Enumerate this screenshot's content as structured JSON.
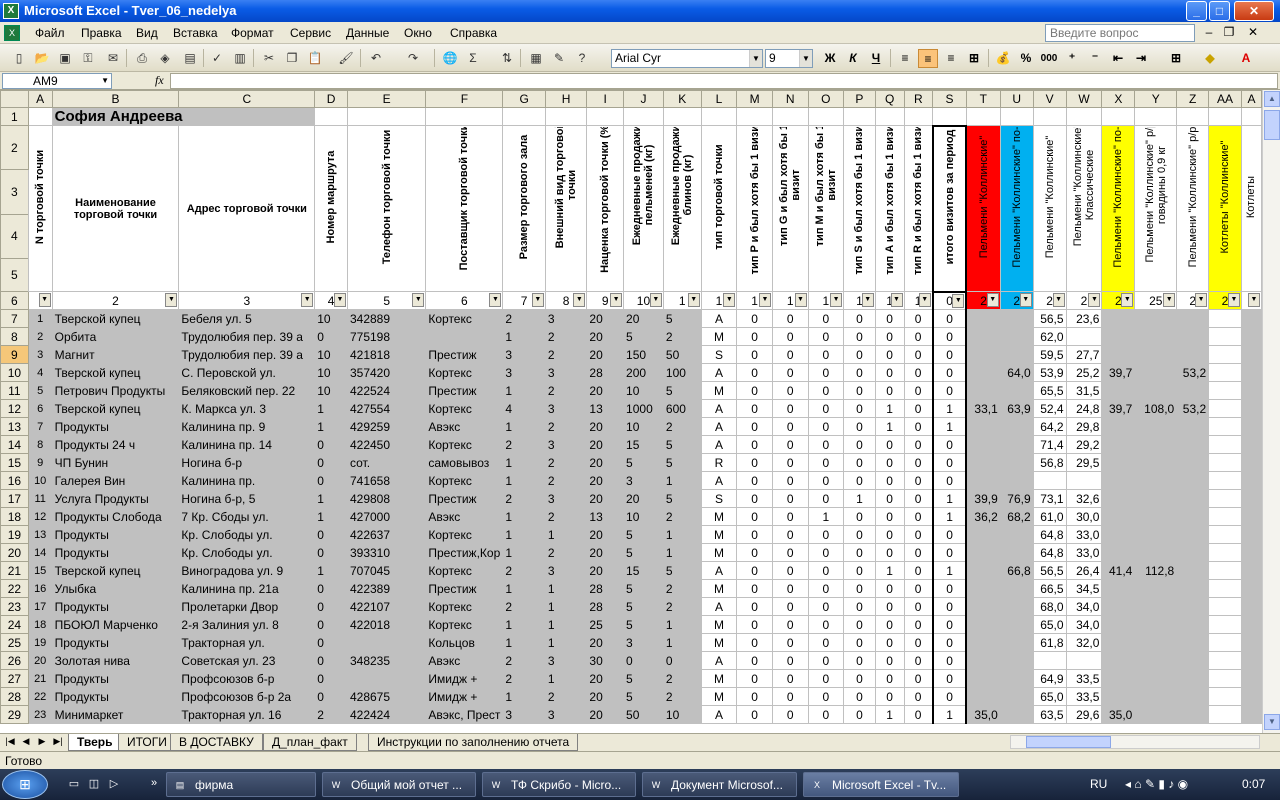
{
  "window": {
    "title": "Microsoft Excel - Tver_06_nedelya",
    "min": "_",
    "max": "□",
    "close": "✕"
  },
  "menu": [
    "Файл",
    "Правка",
    "Вид",
    "Вставка",
    "Формат",
    "Сервис",
    "Данные",
    "Окно",
    "Справка"
  ],
  "ask_placeholder": "Введите вопрос",
  "toolbar": {
    "font": "Arial Cyr",
    "size": "9",
    "sigma": "Σ",
    "percent": "%",
    "thousands": "000",
    "bold": "Ж",
    "italic": "К",
    "underline": "Ч"
  },
  "namebox": "AM9",
  "fx": "fx",
  "columns": [
    "A",
    "B",
    "C",
    "D",
    "E",
    "F",
    "G",
    "H",
    "I",
    "J",
    "K",
    "L",
    "M",
    "N",
    "O",
    "P",
    "Q",
    "R",
    "S",
    "T",
    "U",
    "V",
    "W",
    "X",
    "Y",
    "Z",
    "AA",
    "A"
  ],
  "row1": {
    "num": "1",
    "name": "София Андреева"
  },
  "header_rows": [
    "2",
    "3",
    "4",
    "5"
  ],
  "headers": [
    "N торговой точки",
    "Наименование торговой точки",
    "Адрес торговой точки",
    "Номер маршрута",
    "Телефон торговой точки",
    "Поставщик торговой точки",
    "Размер торгового зала",
    "Внешний вид торговой точки",
    "Наценка торговой точки (%)",
    "Ежедневные продажи пельменей (кг)",
    "Ежедневные продажи блинов (кг)",
    "тип торговой точки",
    "тип P и был хотя бы 1 визит",
    "тип G и был хотя бы 1 визит",
    "тип M и был хотя бы 1 визит",
    "тип S и был хотя бы 1 визит",
    "тип A и был хотя бы 1 визит",
    "тип R и был хотя бы 1 визит",
    "итого визитов за период",
    "Пельмени \"Коллинские\"",
    "Пельмени \"Коллинские\" по-",
    "Пельмени \"Коллинские\"",
    "Пельмени \"Коллинские\" Классические",
    "Пельмени \"Коллинские\" по-",
    "Пельмени \"Коллинские\" р/р из говядины 0,9 кг",
    "Пельмени \"Коллинские\" р/р",
    "Котлеты \"Коллинские\"",
    "Котлеты"
  ],
  "filter_row": {
    "num": "6",
    "labels": [
      "",
      "2",
      "3",
      "4",
      "5",
      "6",
      "7",
      "8",
      "9",
      "10",
      "1",
      "1",
      "1",
      "1",
      "1",
      "1",
      "1",
      "1",
      "0",
      "2",
      "2",
      "2",
      "2",
      "2",
      "25",
      "2",
      "2",
      "2"
    ]
  },
  "rows": [
    {
      "n": "7",
      "c": [
        "1",
        "Тверской купец",
        "Бебеля ул. 5",
        "10",
        "342889",
        "Кортекс",
        "2",
        "3",
        "20",
        "20",
        "5",
        "A",
        "0",
        "0",
        "0",
        "0",
        "0",
        "0",
        "0",
        "",
        "",
        "56,5",
        "23,6",
        "",
        "",
        "",
        "",
        ""
      ]
    },
    {
      "n": "8",
      "c": [
        "2",
        "Орбита",
        "Трудолюбия пер. 39 а",
        "0",
        "775198",
        "",
        "1",
        "2",
        "20",
        "5",
        "2",
        "M",
        "0",
        "0",
        "0",
        "0",
        "0",
        "0",
        "0",
        "",
        "",
        "62,0",
        "",
        "",
        "",
        "",
        "",
        ""
      ]
    },
    {
      "n": "9",
      "c": [
        "3",
        "Магнит",
        "Трудолюбия пер. 39 а",
        "10",
        "421818",
        "Престиж",
        "3",
        "2",
        "20",
        "150",
        "50",
        "S",
        "0",
        "0",
        "0",
        "0",
        "0",
        "0",
        "0",
        "",
        "",
        "59,5",
        "27,7",
        "",
        "",
        "",
        "",
        ""
      ]
    },
    {
      "n": "10",
      "c": [
        "4",
        "Тверской купец",
        "С. Перовской ул.",
        "10",
        "357420",
        "Кортекс",
        "3",
        "3",
        "28",
        "200",
        "100",
        "A",
        "0",
        "0",
        "0",
        "0",
        "0",
        "0",
        "0",
        "",
        "64,0",
        "53,9",
        "25,2",
        "39,7",
        "",
        "53,2",
        "",
        ""
      ]
    },
    {
      "n": "11",
      "c": [
        "5",
        "Петрович Продукты",
        "Беляковский пер. 22",
        "10",
        "422524",
        "Престиж",
        "1",
        "2",
        "20",
        "10",
        "5",
        "M",
        "0",
        "0",
        "0",
        "0",
        "0",
        "0",
        "0",
        "",
        "",
        "65,5",
        "31,5",
        "",
        "",
        "",
        "",
        ""
      ]
    },
    {
      "n": "12",
      "c": [
        "6",
        "Тверской купец",
        "К. Маркса ул. 3",
        "1",
        "427554",
        "Кортекс",
        "4",
        "3",
        "13",
        "1000",
        "600",
        "A",
        "0",
        "0",
        "0",
        "0",
        "1",
        "0",
        "1",
        "33,1",
        "63,9",
        "52,4",
        "24,8",
        "39,7",
        "108,0",
        "53,2",
        "",
        ""
      ]
    },
    {
      "n": "13",
      "c": [
        "7",
        "Продукты",
        "Калинина пр. 9",
        "1",
        "429259",
        "Авэкс",
        "1",
        "2",
        "20",
        "10",
        "2",
        "A",
        "0",
        "0",
        "0",
        "0",
        "1",
        "0",
        "1",
        "",
        "",
        "64,2",
        "29,8",
        "",
        "",
        "",
        "",
        ""
      ]
    },
    {
      "n": "14",
      "c": [
        "8",
        "Продукты 24 ч",
        "Калинина пр. 14",
        "0",
        "422450",
        "Кортекс",
        "2",
        "3",
        "20",
        "15",
        "5",
        "A",
        "0",
        "0",
        "0",
        "0",
        "0",
        "0",
        "0",
        "",
        "",
        "71,4",
        "29,2",
        "",
        "",
        "",
        "",
        ""
      ]
    },
    {
      "n": "15",
      "c": [
        "9",
        "ЧП Бунин",
        "Ногина б-р",
        "0",
        "сот.",
        "самовывоз",
        "1",
        "2",
        "20",
        "5",
        "5",
        "R",
        "0",
        "0",
        "0",
        "0",
        "0",
        "0",
        "0",
        "",
        "",
        "56,8",
        "29,5",
        "",
        "",
        "",
        "",
        ""
      ]
    },
    {
      "n": "16",
      "c": [
        "10",
        "Галерея Вин",
        "Калинина пр.",
        "0",
        "741658",
        "Кортекс",
        "1",
        "2",
        "20",
        "3",
        "1",
        "A",
        "0",
        "0",
        "0",
        "0",
        "0",
        "0",
        "0",
        "",
        "",
        "",
        "",
        "",
        "",
        "",
        "",
        ""
      ]
    },
    {
      "n": "17",
      "c": [
        "11",
        "Услуга Продукты",
        "Ногина б-р, 5",
        "1",
        "429808",
        "Престиж",
        "2",
        "3",
        "20",
        "20",
        "5",
        "S",
        "0",
        "0",
        "0",
        "1",
        "0",
        "0",
        "1",
        "39,9",
        "76,9",
        "73,1",
        "32,6",
        "",
        "",
        "",
        "",
        ""
      ]
    },
    {
      "n": "18",
      "c": [
        "12",
        "Продукты Слобода",
        "7 Кр. Сбоды ул.",
        "1",
        "427000",
        "Авэкс",
        "1",
        "2",
        "13",
        "10",
        "2",
        "M",
        "0",
        "0",
        "1",
        "0",
        "0",
        "0",
        "1",
        "36,2",
        "68,2",
        "61,0",
        "30,0",
        "",
        "",
        "",
        "",
        ""
      ]
    },
    {
      "n": "19",
      "c": [
        "13",
        "Продукты",
        "Кр. Слободы ул.",
        "0",
        "422637",
        "Кортекс",
        "1",
        "1",
        "20",
        "5",
        "1",
        "M",
        "0",
        "0",
        "0",
        "0",
        "0",
        "0",
        "0",
        "",
        "",
        "64,8",
        "33,0",
        "",
        "",
        "",
        "",
        ""
      ]
    },
    {
      "n": "20",
      "c": [
        "14",
        "Продукты",
        "Кр. Слободы ул.",
        "0",
        "393310",
        "Престиж,Кор",
        "1",
        "2",
        "20",
        "5",
        "1",
        "M",
        "0",
        "0",
        "0",
        "0",
        "0",
        "0",
        "0",
        "",
        "",
        "64,8",
        "33,0",
        "",
        "",
        "",
        "",
        ""
      ]
    },
    {
      "n": "21",
      "c": [
        "15",
        "Тверской купец",
        "Виноградова ул. 9",
        "1",
        "707045",
        "Кортекс",
        "2",
        "3",
        "20",
        "15",
        "5",
        "A",
        "0",
        "0",
        "0",
        "0",
        "1",
        "0",
        "1",
        "",
        "66,8",
        "56,5",
        "26,4",
        "41,4",
        "112,8",
        "",
        "",
        ""
      ]
    },
    {
      "n": "22",
      "c": [
        "16",
        "Улыбка",
        "Калинина пр. 21а",
        "0",
        "422389",
        "Престиж",
        "1",
        "1",
        "28",
        "5",
        "2",
        "M",
        "0",
        "0",
        "0",
        "0",
        "0",
        "0",
        "0",
        "",
        "",
        "66,5",
        "34,5",
        "",
        "",
        "",
        "",
        ""
      ]
    },
    {
      "n": "23",
      "c": [
        "17",
        "Продукты",
        "Пролетарки Двор",
        "0",
        "422107",
        "Кортекс",
        "2",
        "1",
        "28",
        "5",
        "2",
        "A",
        "0",
        "0",
        "0",
        "0",
        "0",
        "0",
        "0",
        "",
        "",
        "68,0",
        "34,0",
        "",
        "",
        "",
        "",
        ""
      ]
    },
    {
      "n": "24",
      "c": [
        "18",
        "ПБОЮЛ Марченко",
        "2-я Залиния ул. 8",
        "0",
        "422018",
        "Кортекс",
        "1",
        "1",
        "25",
        "5",
        "1",
        "M",
        "0",
        "0",
        "0",
        "0",
        "0",
        "0",
        "0",
        "",
        "",
        "65,0",
        "34,0",
        "",
        "",
        "",
        "",
        ""
      ]
    },
    {
      "n": "25",
      "c": [
        "19",
        "Продукты",
        "Тракторная ул.",
        "0",
        "",
        "Кольцов",
        "1",
        "1",
        "20",
        "3",
        "1",
        "M",
        "0",
        "0",
        "0",
        "0",
        "0",
        "0",
        "0",
        "",
        "",
        "61,8",
        "32,0",
        "",
        "",
        "",
        "",
        ""
      ]
    },
    {
      "n": "26",
      "c": [
        "20",
        "Золотая нива",
        "Советская ул. 23",
        "0",
        "348235",
        "Авэкс",
        "2",
        "3",
        "30",
        "0",
        "0",
        "A",
        "0",
        "0",
        "0",
        "0",
        "0",
        "0",
        "0",
        "",
        "",
        "",
        "",
        "",
        "",
        "",
        "",
        ""
      ]
    },
    {
      "n": "27",
      "c": [
        "21",
        "Продукты",
        "Профсоюзов б-р",
        "0",
        "",
        "Имидж +",
        "2",
        "1",
        "20",
        "5",
        "2",
        "M",
        "0",
        "0",
        "0",
        "0",
        "0",
        "0",
        "0",
        "",
        "",
        "64,9",
        "33,5",
        "",
        "",
        "",
        "",
        ""
      ]
    },
    {
      "n": "28",
      "c": [
        "22",
        "Продукты",
        "Профсоюзов б-р 2а",
        "0",
        "428675",
        "Имидж +",
        "1",
        "2",
        "20",
        "5",
        "2",
        "M",
        "0",
        "0",
        "0",
        "0",
        "0",
        "0",
        "0",
        "",
        "",
        "65,0",
        "33,5",
        "",
        "",
        "",
        "",
        ""
      ]
    },
    {
      "n": "29",
      "c": [
        "23",
        "Минимаркет",
        "Тракторная ул. 16",
        "2",
        "422424",
        "Авэкс, Прест",
        "3",
        "3",
        "20",
        "50",
        "10",
        "A",
        "0",
        "0",
        "0",
        "0",
        "1",
        "0",
        "1",
        "35,0",
        "",
        "63,5",
        "29,6",
        "35,0",
        "",
        "",
        "",
        ""
      ]
    }
  ],
  "sheets": [
    "Тверь",
    "ИТОГИ",
    "В ДОСТАВКУ",
    "Д_план_факт",
    "Инструкции по заполнению отчета"
  ],
  "status": "Готово",
  "taskbar": {
    "items": [
      "фирма",
      "Общий мой отчет ...",
      "ТФ Скрибо - Micro...",
      "Документ Microsof...",
      "Microsoft Excel - Tv..."
    ],
    "lang": "RU",
    "clock": "0:07"
  }
}
